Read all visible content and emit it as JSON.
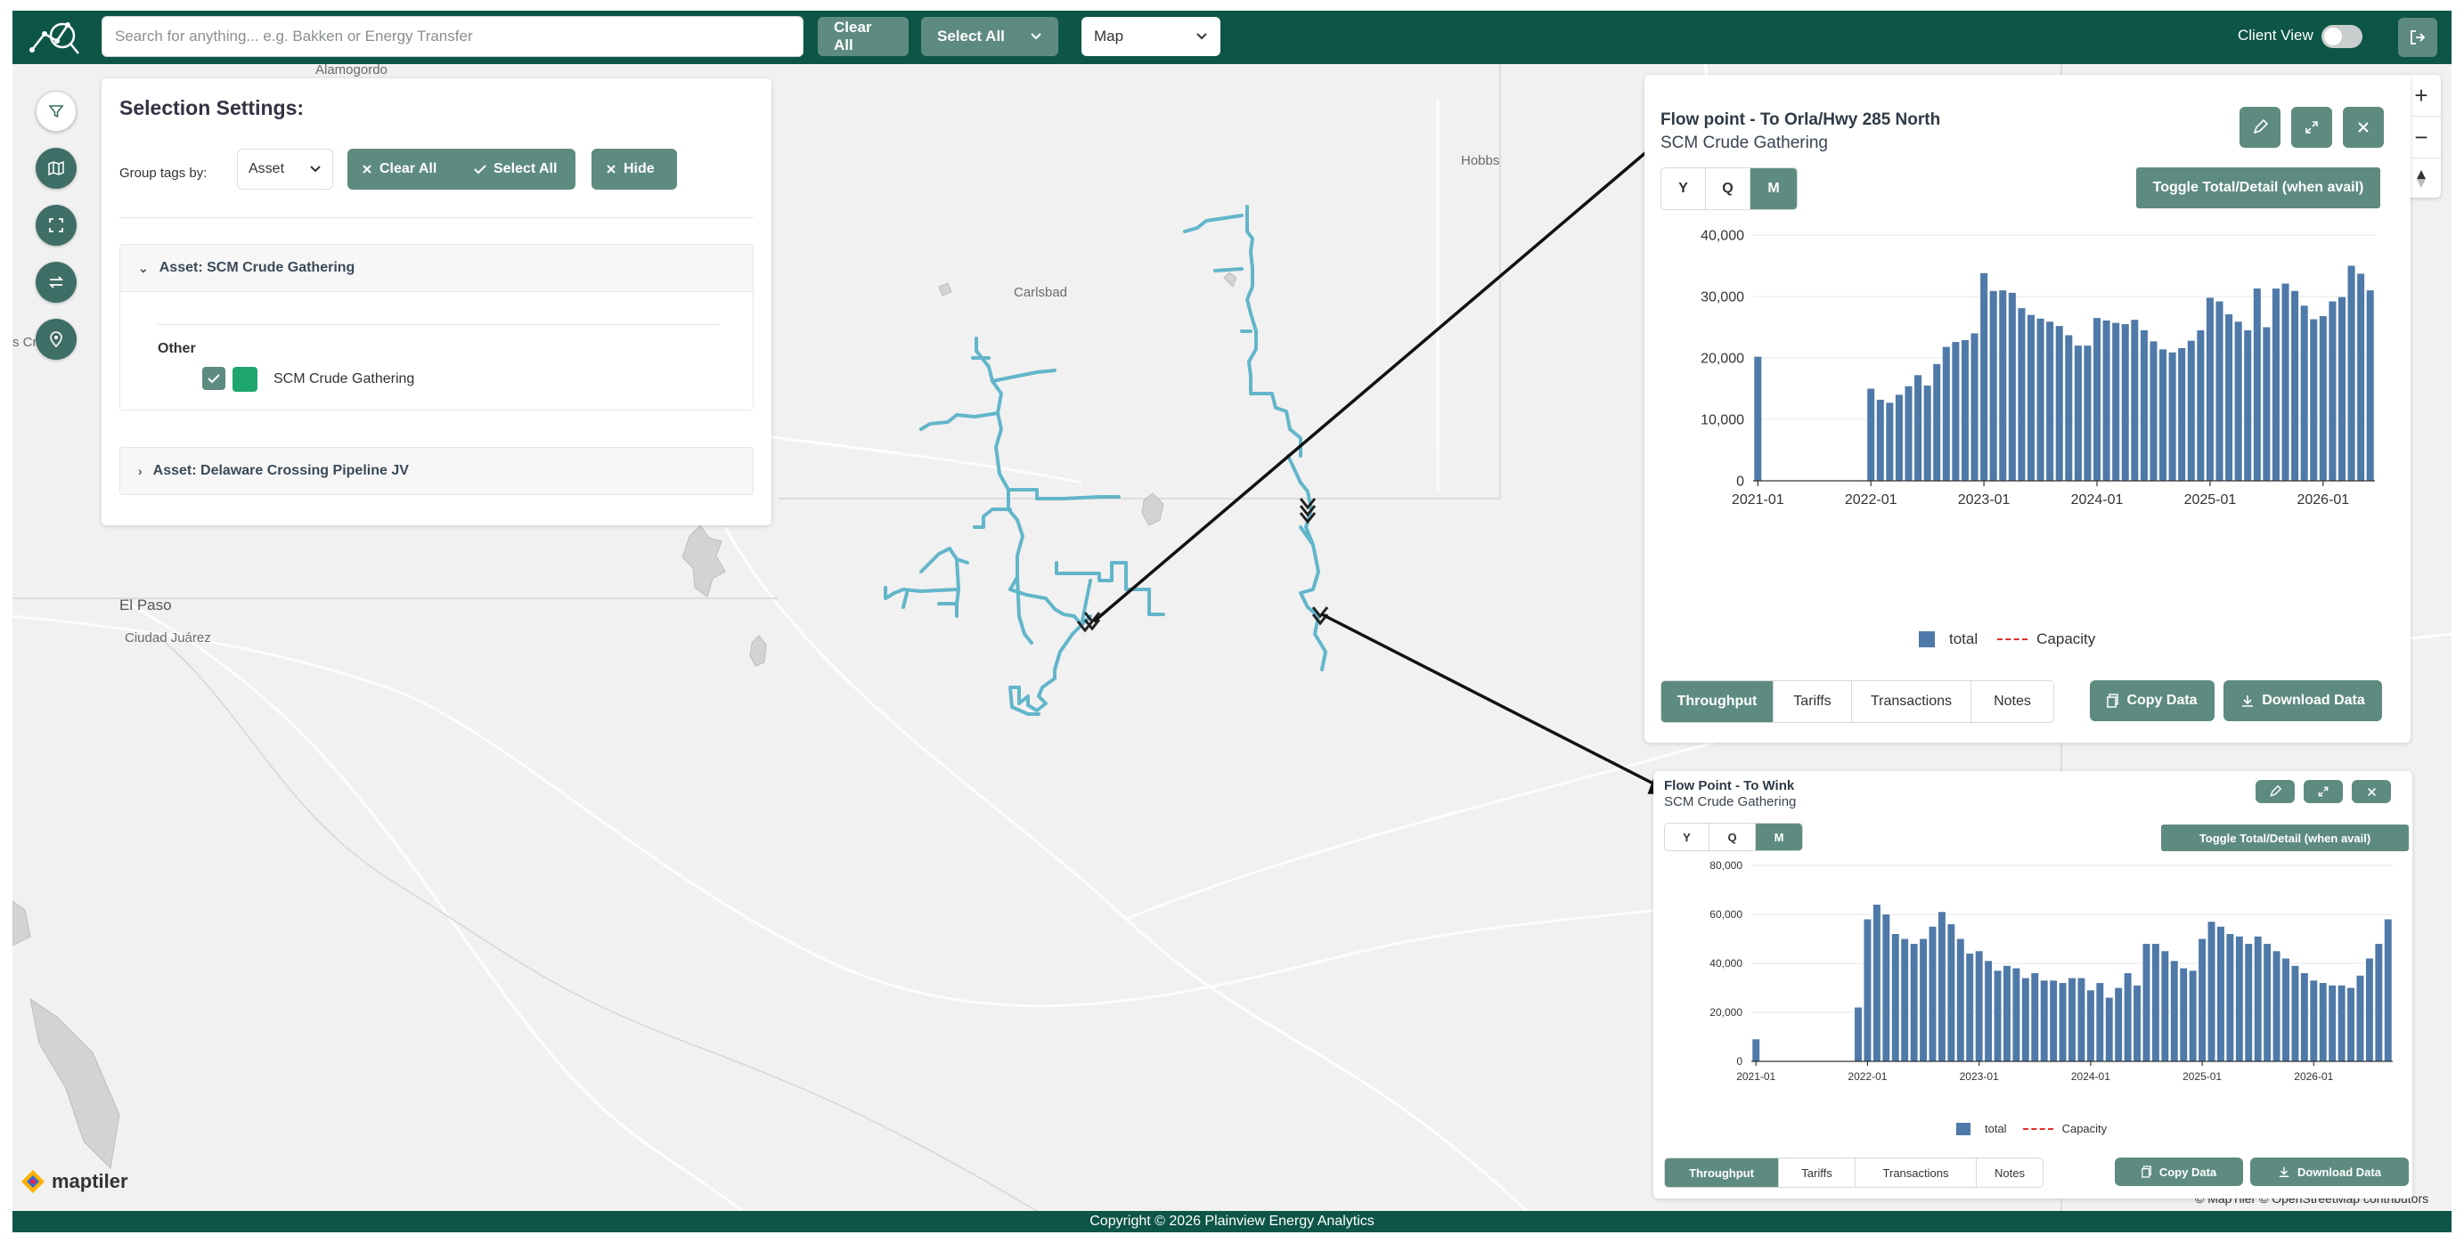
{
  "topbar": {
    "search_placeholder": "Search for anything... e.g. Bakken or Energy Transfer",
    "clear_all": "Clear All",
    "select_all": "Select All",
    "view_select": "Map",
    "client_view": "Client View",
    "client_view_on": false
  },
  "map": {
    "labels": {
      "alamogordo": "Alamogordo",
      "hobbs": "Hobbs",
      "carlsbad": "Carlsbad",
      "el_paso": "El Paso",
      "ciudad_juarez": "Ciudad Juárez",
      "cruces": "s Cruce"
    },
    "attribution": "© MapTiler © OpenStreetMap contributors",
    "maptiler_logo": "maptiler",
    "route_color": "#62b6ca"
  },
  "selection": {
    "title": "Selection Settings:",
    "group_label": "Group tags by:",
    "group_value": "Asset",
    "clear_all": "Clear All",
    "select_all": "Select All",
    "hide": "Hide",
    "assets": [
      {
        "label": "Asset: SCM Crude Gathering",
        "expanded": true,
        "group": "Other",
        "item": "SCM Crude Gathering",
        "color": "#1fa66e",
        "checked": true
      },
      {
        "label": "Asset: Delaware Crossing Pipeline JV",
        "expanded": false
      }
    ]
  },
  "panels": [
    {
      "title": "Flow point - To Orla/Hwy 285 North",
      "subtitle": "SCM Crude Gathering",
      "periods": [
        "Y",
        "Q",
        "M"
      ],
      "active_period": "M",
      "toggle_label": "Toggle Total/Detail (when avail)",
      "tabs": [
        "Throughput",
        "Tariffs",
        "Transactions",
        "Notes"
      ],
      "active_tab": "Throughput",
      "copy_label": "Copy Data",
      "download_label": "Download Data"
    },
    {
      "title": "Flow Point - To Wink",
      "subtitle": "SCM Crude Gathering",
      "periods": [
        "Y",
        "Q",
        "M"
      ],
      "active_period": "M",
      "toggle_label": "Toggle Total/Detail (when avail)",
      "tabs": [
        "Throughput",
        "Tariffs",
        "Transactions",
        "Notes"
      ],
      "active_tab": "Throughput",
      "copy_label": "Copy Data",
      "download_label": "Download Data"
    }
  ],
  "chart_data": [
    {
      "type": "bar",
      "title": "",
      "x_start": "2021-01",
      "interval": "month",
      "x_ticks": [
        "2021-01",
        "2022-01",
        "2023-01",
        "2024-01",
        "2025-01",
        "2026-01"
      ],
      "y_ticks": [
        0,
        10000,
        20000,
        30000,
        40000
      ],
      "ylim": [
        0,
        40000
      ],
      "bar_color": "#4f79a8",
      "legend": [
        {
          "name": "total",
          "style": "bar",
          "color": "#4f79a8"
        },
        {
          "name": "Capacity",
          "style": "dashed",
          "color": "#e03030"
        }
      ],
      "series": [
        {
          "name": "total",
          "values": [
            20200,
            0,
            0,
            0,
            0,
            0,
            0,
            0,
            0,
            0,
            0,
            0,
            15000,
            13200,
            12700,
            14000,
            15400,
            17200,
            15500,
            19000,
            21800,
            22600,
            22900,
            24000,
            33800,
            30900,
            31000,
            30600,
            28100,
            27000,
            26400,
            25900,
            25200,
            23700,
            22000,
            22000,
            26500,
            26100,
            25700,
            25500,
            26200,
            24500,
            22700,
            21400,
            20900,
            21600,
            22800,
            24500,
            29800,
            29200,
            27100,
            25900,
            24500,
            31300,
            25000,
            31300,
            32100,
            30900,
            28500,
            26300,
            26800,
            29200,
            29900,
            35000,
            33700,
            31000
          ]
        }
      ]
    },
    {
      "type": "bar",
      "title": "",
      "x_start": "2021-01",
      "interval": "month",
      "x_ticks": [
        "2021-01",
        "2022-01",
        "2023-01",
        "2024-01",
        "2025-01",
        "2026-01"
      ],
      "y_ticks": [
        0,
        20000,
        40000,
        60000,
        80000
      ],
      "ylim": [
        0,
        80000
      ],
      "bar_color": "#4f79a8",
      "legend": [
        {
          "name": "total",
          "style": "bar",
          "color": "#4f79a8"
        },
        {
          "name": "Capacity",
          "style": "dashed",
          "color": "#e03030"
        }
      ],
      "series": [
        {
          "name": "total",
          "values": [
            9000,
            0,
            0,
            0,
            0,
            0,
            0,
            0,
            0,
            0,
            0,
            22000,
            58000,
            64000,
            60000,
            52000,
            50000,
            48000,
            50000,
            55000,
            61000,
            56000,
            50000,
            44000,
            45000,
            41000,
            37000,
            39000,
            38000,
            34000,
            36000,
            33000,
            33000,
            32000,
            34000,
            34000,
            29000,
            32000,
            26000,
            30000,
            36000,
            31000,
            48000,
            48000,
            45000,
            41000,
            38000,
            37000,
            50000,
            57000,
            55000,
            52000,
            51000,
            48000,
            51000,
            48000,
            45000,
            42000,
            39000,
            36000,
            33000,
            32000,
            31000,
            31000,
            30000,
            35000,
            42000,
            48000,
            58000
          ]
        }
      ]
    }
  ],
  "footer": {
    "copyright": "Copyright © 2026 Plainview Energy Analytics"
  }
}
